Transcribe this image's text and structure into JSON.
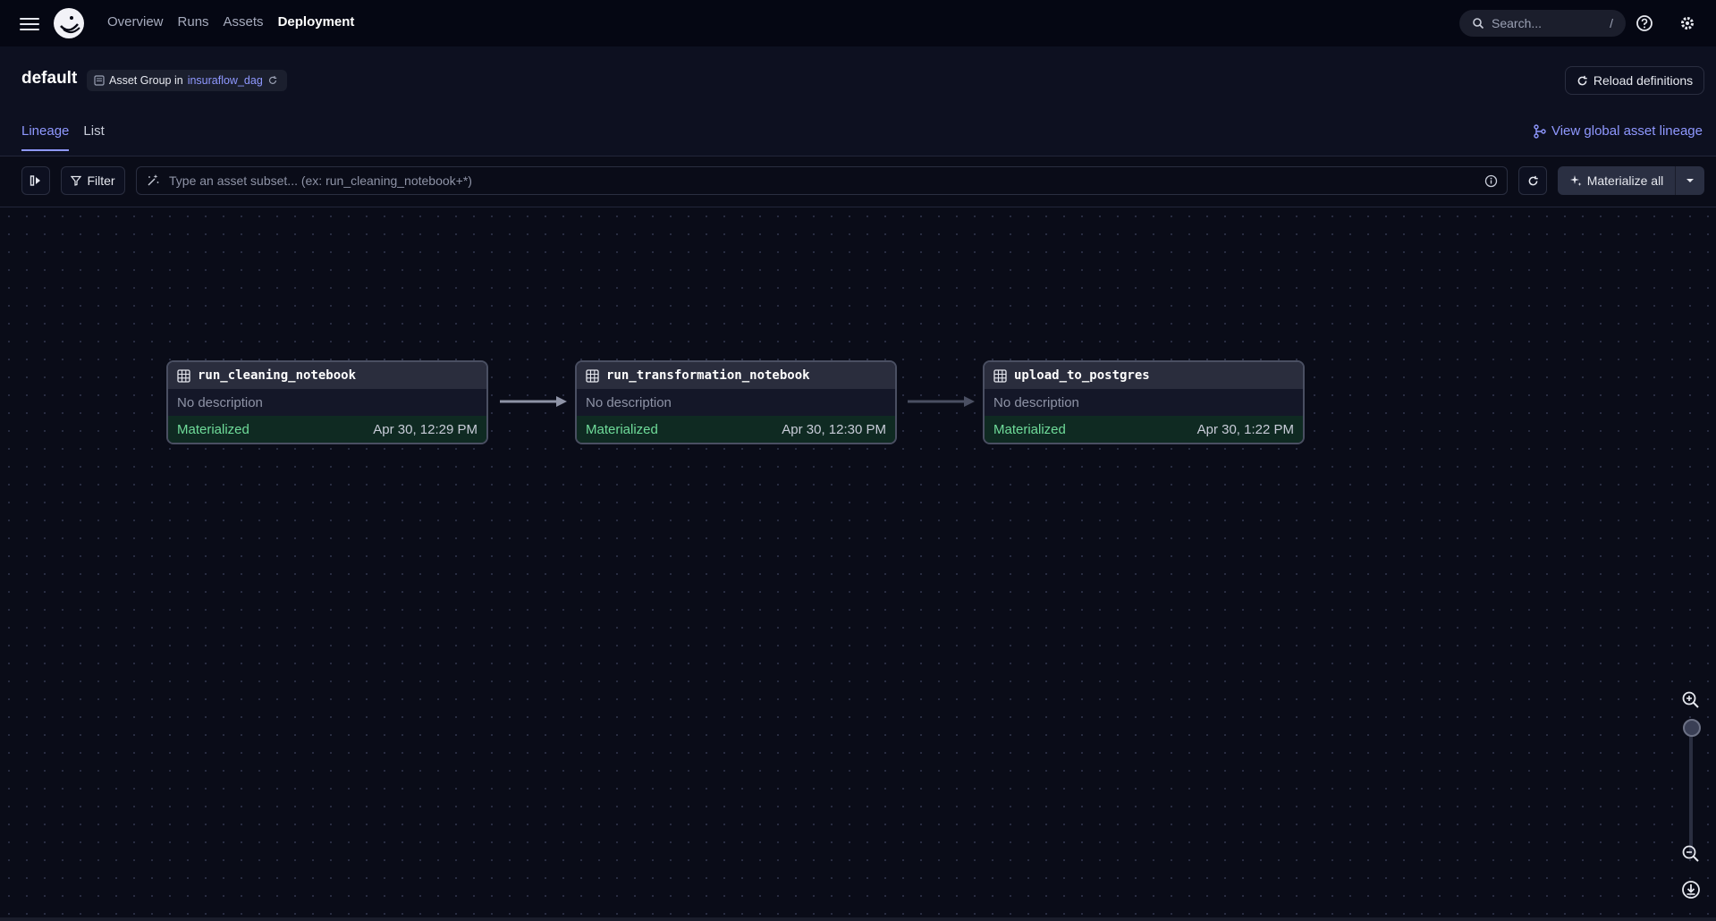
{
  "nav": {
    "items": [
      "Overview",
      "Runs",
      "Assets",
      "Deployment"
    ],
    "active": "Deployment"
  },
  "search": {
    "placeholder": "Search...",
    "shortcut": "/"
  },
  "header": {
    "title": "default",
    "group_prefix": "Asset Group in",
    "group_link": "insuraflow_dag",
    "reload_label": "Reload definitions"
  },
  "tabs": [
    {
      "label": "Lineage",
      "active": true
    },
    {
      "label": "List",
      "active": false
    }
  ],
  "global_lineage_label": "View global asset lineage",
  "toolbar": {
    "filter_label": "Filter",
    "subset_placeholder": "Type an asset subset... (ex: run_cleaning_notebook+*)",
    "materialize_label": "Materialize all"
  },
  "nodes": [
    {
      "name": "run_cleaning_notebook",
      "description": "No description",
      "status": "Materialized",
      "timestamp": "Apr 30, 12:29 PM"
    },
    {
      "name": "run_transformation_notebook",
      "description": "No description",
      "status": "Materialized",
      "timestamp": "Apr 30, 12:30 PM"
    },
    {
      "name": "upload_to_postgres",
      "description": "No description",
      "status": "Materialized",
      "timestamp": "Apr 30, 1:22 PM"
    }
  ],
  "colors": {
    "accent": "#8f98ff",
    "materialized": "#6fdc9a",
    "background": "#0a0c18"
  }
}
